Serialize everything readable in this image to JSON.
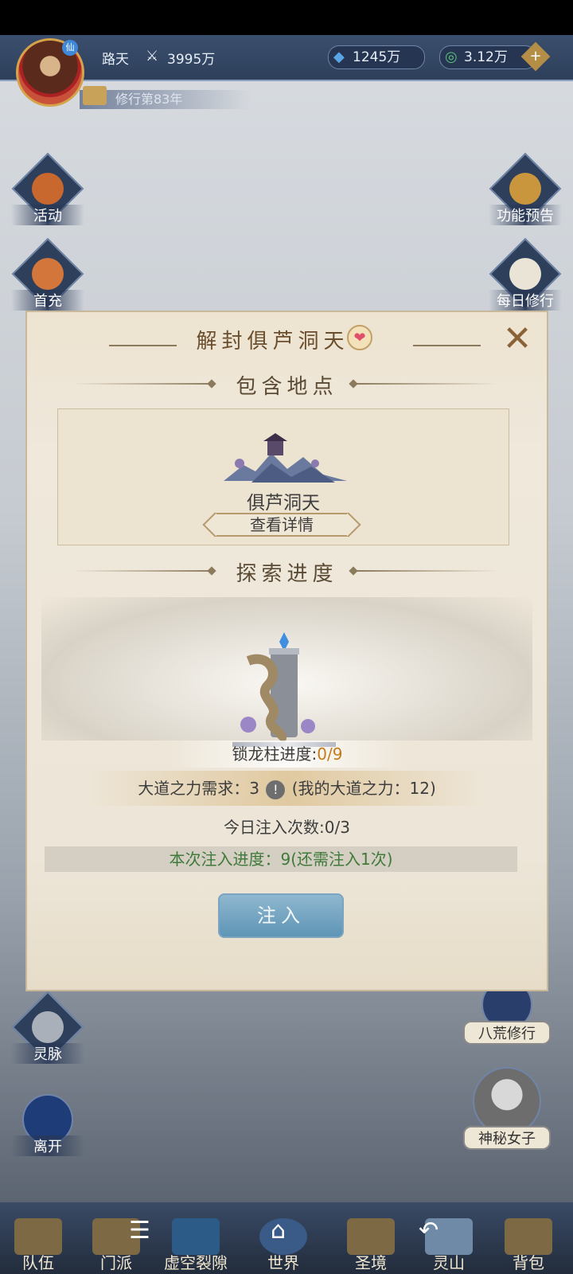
{
  "header": {
    "player_name": "路天",
    "power_value": "3995万",
    "currency1": "1245万",
    "currency2": "3.12万",
    "cultivation_year": "修行第83年",
    "plus": "+",
    "badge": "仙"
  },
  "left_buttons": [
    "活动",
    "首充",
    "灵脉",
    "离开"
  ],
  "right_buttons": [
    "功能预告",
    "每日修行",
    "八荒修行",
    "神秘女子"
  ],
  "dialog": {
    "title": "解封俱芦洞天",
    "close": "✕",
    "heart": "❤",
    "section_locations": "包含地点",
    "location_name": "俱芦洞天",
    "view_detail": "查看详情",
    "section_progress": "探索进度",
    "pillar_label": "锁龙柱进度:",
    "pillar_progress": "0/9",
    "dao_requirement_prefix": "大道之力需求：3",
    "warn": "!",
    "dao_requirement_suffix": "(我的大道之力：12)",
    "today_injections": "今日注入次数:0/3",
    "current_injection": "本次注入进度：9(还需注入1次)",
    "inject_button": "注入"
  },
  "bottom_nav": [
    "队伍",
    "门派",
    "虚空裂隙",
    "世界",
    "圣境",
    "灵山",
    "背包"
  ],
  "system_nav": [
    "☰",
    "⌂",
    "↶"
  ]
}
